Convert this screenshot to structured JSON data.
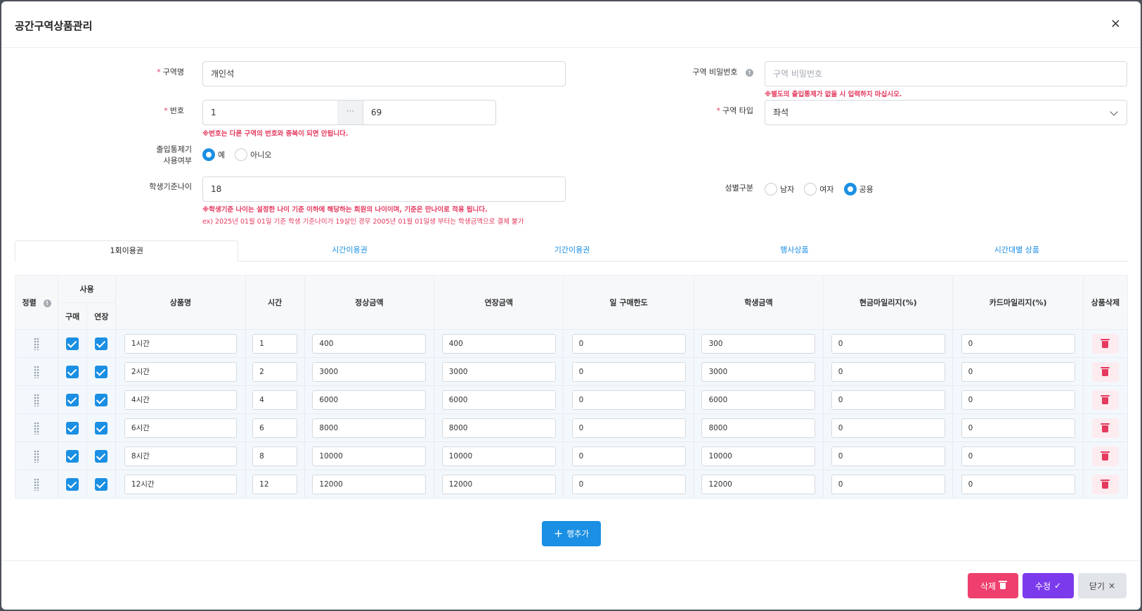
{
  "modal": {
    "title": "공간구역상품관리",
    "close": "×"
  },
  "form": {
    "zone_name": {
      "label": "구역명",
      "value": "개인석"
    },
    "zone_password": {
      "label": "구역 비밀번호",
      "placeholder": "구역 비밀번호",
      "hint": "※별도의 출입통제가 없을 시 입력하지 마십시오."
    },
    "number": {
      "label": "번호",
      "from": "1",
      "separator": "···",
      "to": "69",
      "hint": "※번호는 다른 구역의 번호와 중복이 되면 안됩니다."
    },
    "zone_type": {
      "label": "구역 타입",
      "value": "좌석"
    },
    "access_control": {
      "label_line1": "출입통제기",
      "label_line2": "사용여부",
      "options": [
        "예",
        "아니오"
      ],
      "selected": "예"
    },
    "student_age": {
      "label": "학생기준나이",
      "value": "18",
      "hint1": "※학생기준 나이는 설정한 나이 기준 이하에 해당하는 회원의 나이이며, 기준은 만나이로 적용 됩니다.",
      "hint2": "ex) 2025년 01월 01일 기준 학생 기준나이가 19살인 경우 2005년 01월 01일생 부터는 학생금액으로 결제 불가"
    },
    "gender": {
      "label": "성별구분",
      "options": [
        "남자",
        "여자",
        "공용"
      ],
      "selected": "공용"
    }
  },
  "tabs": [
    "1회이용권",
    "시간이용권",
    "기간이용권",
    "행사상품",
    "시간대별 상품"
  ],
  "active_tab": "1회이용권",
  "table": {
    "headers": {
      "sort": "정렬",
      "use": "사용",
      "buy": "구매",
      "extend": "연장",
      "name": "상품명",
      "time": "시간",
      "price": "정상금액",
      "extend_price": "연장금액",
      "daily_limit": "일 구매한도",
      "student_price": "학생금액",
      "cash_mileage": "현금마일리지(%)",
      "card_mileage": "카드마일리지(%)",
      "delete": "상품삭제"
    },
    "rows": [
      {
        "name": "1시간",
        "time": "1",
        "price": "400",
        "extend_price": "400",
        "daily_limit": "0",
        "student_price": "300",
        "cash_mileage": "0",
        "card_mileage": "0"
      },
      {
        "name": "2시간",
        "time": "2",
        "price": "3000",
        "extend_price": "3000",
        "daily_limit": "0",
        "student_price": "3000",
        "cash_mileage": "0",
        "card_mileage": "0"
      },
      {
        "name": "4시간",
        "time": "4",
        "price": "6000",
        "extend_price": "6000",
        "daily_limit": "0",
        "student_price": "6000",
        "cash_mileage": "0",
        "card_mileage": "0"
      },
      {
        "name": "6시간",
        "time": "6",
        "price": "8000",
        "extend_price": "8000",
        "daily_limit": "0",
        "student_price": "8000",
        "cash_mileage": "0",
        "card_mileage": "0"
      },
      {
        "name": "8시간",
        "time": "8",
        "price": "10000",
        "extend_price": "10000",
        "daily_limit": "0",
        "student_price": "10000",
        "cash_mileage": "0",
        "card_mileage": "0"
      },
      {
        "name": "12시간",
        "time": "12",
        "price": "12000",
        "extend_price": "12000",
        "daily_limit": "0",
        "student_price": "12000",
        "cash_mileage": "0",
        "card_mileage": "0"
      }
    ]
  },
  "add_row_label": "행추가",
  "footer": {
    "delete_label": "삭제",
    "edit_label": "수정",
    "close_label": "닫기"
  },
  "colors": {
    "primary": "#1a8fe3",
    "danger": "#ee3f6e",
    "purple": "#7c3aed"
  }
}
